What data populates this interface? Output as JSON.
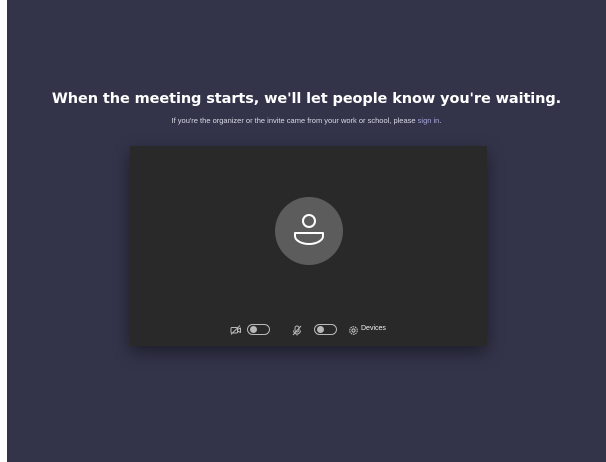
{
  "lobby": {
    "headline": "When the meeting starts, we'll let people know you're waiting.",
    "subtext_prefix": "If you're the organizer or the invite came from your work or school, please",
    "sign_in_link": "sign in",
    "subtext_suffix": "."
  },
  "preview": {
    "avatar_icon": "person-icon",
    "controls": {
      "camera": {
        "icon": "camera-off-icon",
        "enabled": false
      },
      "microphone": {
        "icon": "mic-off-icon",
        "enabled": false
      },
      "devices": {
        "icon": "gear-icon",
        "label": "Devices"
      }
    }
  },
  "colors": {
    "background": "#33344a",
    "preview": "#292929",
    "avatar": "#5c5c5c",
    "link": "#a6a7dc"
  }
}
